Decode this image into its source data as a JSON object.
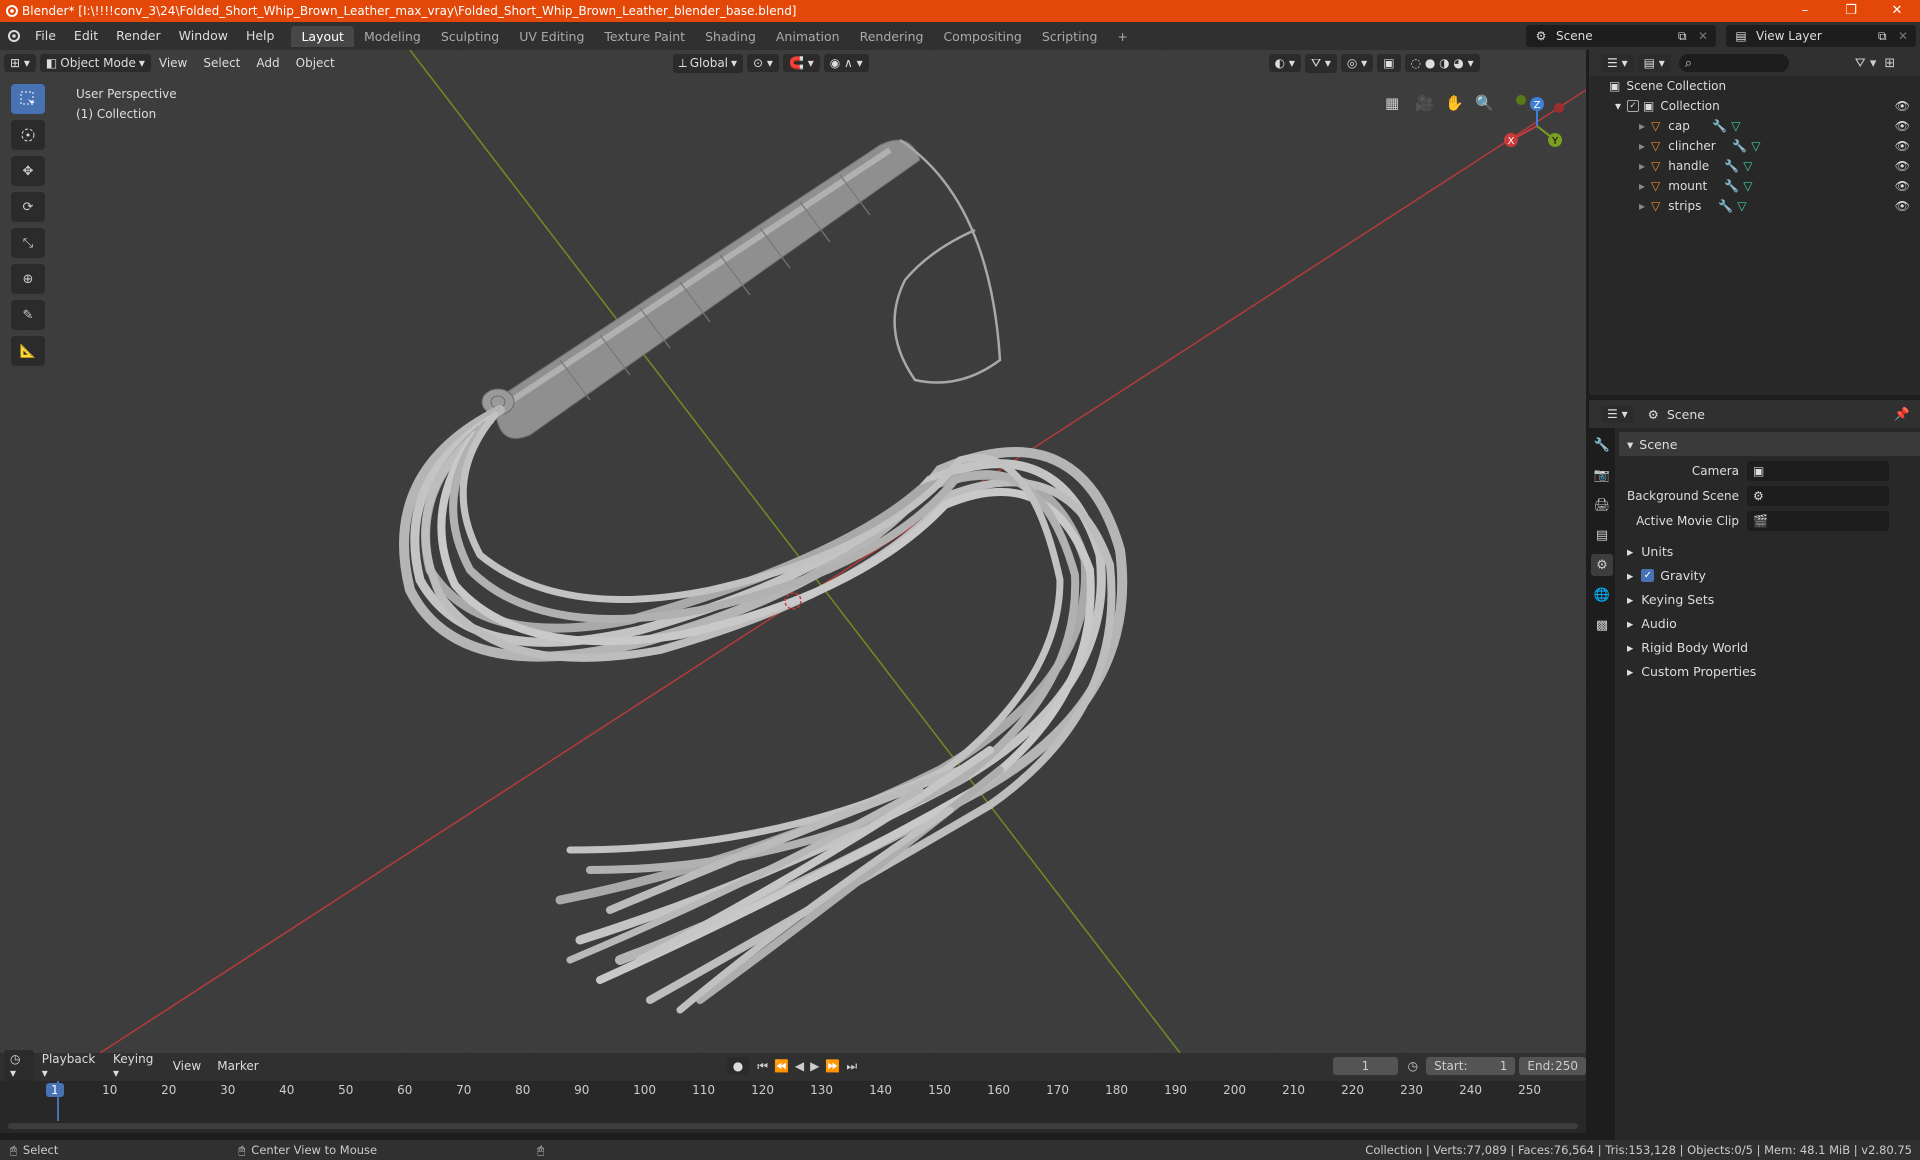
{
  "window": {
    "title": "Blender* [I:\\!!!!conv_3\\24\\Folded_Short_Whip_Brown_Leather_max_vray\\Folded_Short_Whip_Brown_Leather_blender_base.blend]"
  },
  "menu": [
    "File",
    "Edit",
    "Render",
    "Window",
    "Help"
  ],
  "workspaces": [
    "Layout",
    "Modeling",
    "Sculpting",
    "UV Editing",
    "Texture Paint",
    "Shading",
    "Animation",
    "Rendering",
    "Compositing",
    "Scripting"
  ],
  "scene_name": "Scene",
  "view_layer": "View Layer",
  "viewport": {
    "mode": "Object Mode",
    "menus": [
      "View",
      "Select",
      "Add",
      "Object"
    ],
    "orientation": "Global",
    "perspective": "User Perspective",
    "collection": "(1) Collection",
    "gizmo": {
      "x": "X",
      "y": "Y",
      "z": "Z"
    }
  },
  "outliner": {
    "root": "Scene Collection",
    "collection": "Collection",
    "objects": [
      "cap",
      "clincher",
      "handle",
      "mount",
      "strips"
    ]
  },
  "properties": {
    "header": "Scene",
    "section": "Scene",
    "fields": [
      {
        "label": "Camera",
        "value": ""
      },
      {
        "label": "Background Scene",
        "value": ""
      },
      {
        "label": "Active Movie Clip",
        "value": ""
      }
    ],
    "subsections": [
      "Units",
      "Gravity",
      "Keying Sets",
      "Audio",
      "Rigid Body World",
      "Custom Properties"
    ],
    "gravity_checked": true
  },
  "timeline": {
    "menus": [
      "Playback",
      "Keying",
      "View",
      "Marker"
    ],
    "current_frame": "1",
    "start_label": "Start:",
    "start": "1",
    "end_label": "End:",
    "end": "250",
    "ticks": [
      "1",
      "10",
      "20",
      "30",
      "40",
      "50",
      "60",
      "70",
      "80",
      "90",
      "100",
      "110",
      "120",
      "130",
      "140",
      "150",
      "160",
      "170",
      "180",
      "190",
      "200",
      "210",
      "220",
      "230",
      "240",
      "250"
    ]
  },
  "statusbar": {
    "left1": "Select",
    "left2": "Center View to Mouse",
    "right": "Collection | Verts:77,089 | Faces:76,564 | Tris:153,128 | Objects:0/5 | Mem: 48.1 MiB | v2.80.75"
  },
  "colors": {
    "accent": "#4772b3",
    "titlebar": "#e44809",
    "x_axis": "#c93a3a",
    "y_axis": "#7a9e1f",
    "z_axis": "#3f7fd6"
  }
}
